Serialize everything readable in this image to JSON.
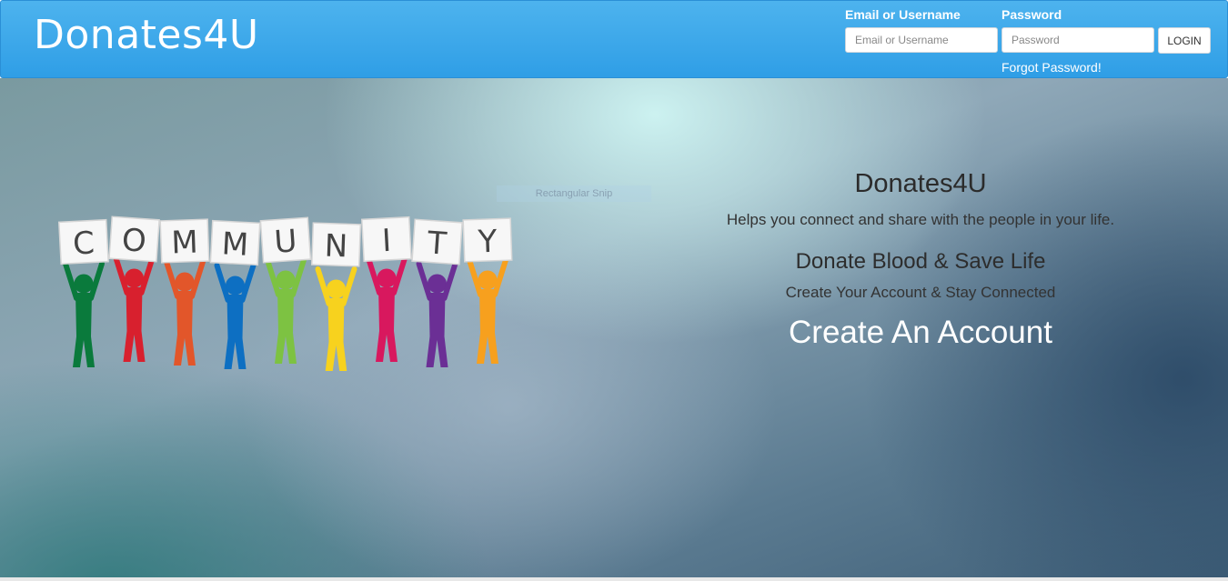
{
  "brand": "Donates4U",
  "login_form": {
    "username_label": "Email or Username",
    "username_placeholder": "Email or Username",
    "password_label": "Password",
    "password_placeholder": "Password",
    "login_button": "LOGIN",
    "forgot_link": "Forgot Password!"
  },
  "overlay_label": "Rectangular Snip",
  "community_letters": [
    "C",
    "O",
    "M",
    "M",
    "U",
    "N",
    "I",
    "T",
    "Y"
  ],
  "figure_colors": [
    "#0a7a3c",
    "#d8202e",
    "#e2562a",
    "#0d6fc2",
    "#7dc242",
    "#f7d21e",
    "#d8185e",
    "#6b2f95",
    "#f7a01e"
  ],
  "hero": {
    "heading": "Donates4U",
    "tagline": "Helps you connect and share with the people in your life.",
    "subheading": "Donate Blood & Save Life",
    "subtext": "Create Your Account & Stay Connected",
    "cta": "Create An Account"
  }
}
